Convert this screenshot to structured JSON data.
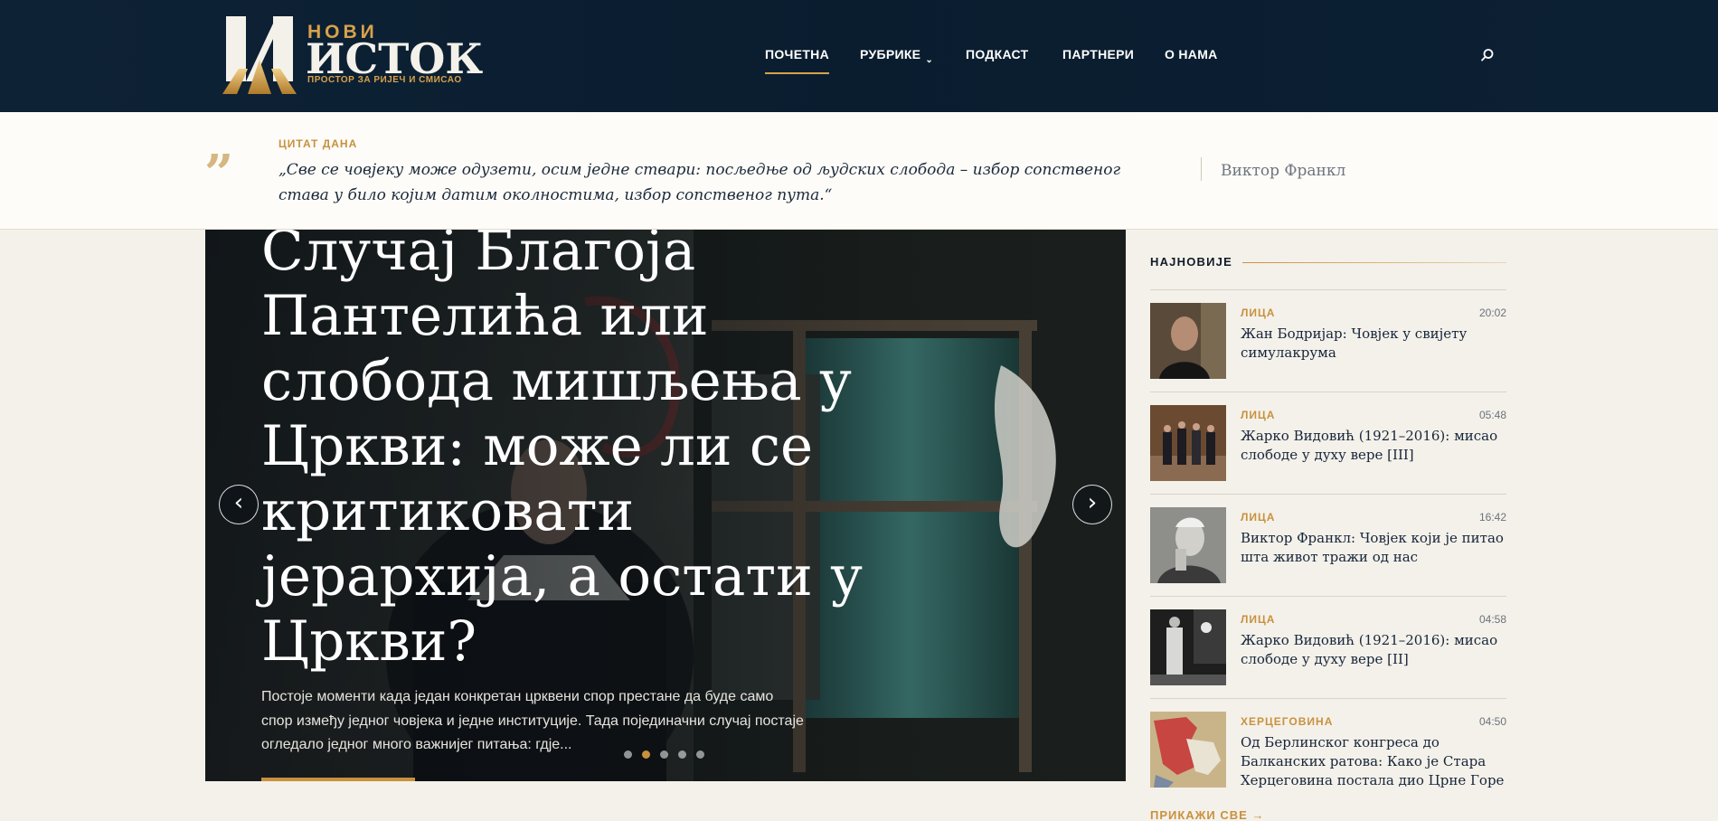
{
  "brand": {
    "name_top": "НОВИ",
    "name_main": "ИСТОК",
    "tagline": "ПРОСТОР ЗА РИЈЕЧ И СМИСАО"
  },
  "nav": {
    "items": [
      {
        "label": "ПОЧЕТНА",
        "active": true
      },
      {
        "label": "РУБРИКЕ",
        "has_dropdown": true
      },
      {
        "label": "ПОДКАСТ"
      },
      {
        "label": "ПАРТНЕРИ"
      },
      {
        "label": "О НАМА"
      }
    ],
    "search_icon": "search-icon"
  },
  "quote": {
    "label": "ЦИТАТ ДАНА",
    "text": "„Све се човјеку може одузети, осим једне ствари: посљедње од људских слобода – избор сопственог става у било којим датим околностима, избор сопственог пута.“",
    "author": "Виктор Франкл"
  },
  "hero": {
    "title": "Случај Благоја Пантелића или слобода мишљења у Цркви: може ли се критиковати јерархија, а остати у Цркви?",
    "excerpt": "Постоје моменти када један конкретан црквени спор престане да буде само спор између једног човјека и једне институције. Тада појединачни случај постаје огледало једног много важнијег питања: гдје...",
    "prev_label": "‹",
    "next_label": "›",
    "slides_count": 5,
    "active_slide": 2
  },
  "sidebar": {
    "heading": "НАЈНОВИЈЕ",
    "items": [
      {
        "category": "ЛИЦА",
        "time": "20:02",
        "title": "Жан Бодријар: Човјек у свијету симулакрума"
      },
      {
        "category": "ЛИЦА",
        "time": "05:48",
        "title": "Жарко Видовић (1921–2016): мисао слободе у духу вере [III]"
      },
      {
        "category": "ЛИЦА",
        "time": "16:42",
        "title": "Виктор Франкл: Човјек који је питао шта живот тражи од нас"
      },
      {
        "category": "ЛИЦА",
        "time": "04:58",
        "title": "Жарко Видовић (1921–2016): мисао слободе у духу вере [II]"
      },
      {
        "category": "ХЕРЦЕГОВИНА",
        "time": "04:50",
        "title": "Од Берлинског конгреса до Балканских ратова: Како је Стара Херцеговина постала дио Црне Горе"
      }
    ],
    "more_label": "ПРИКАЖИ СВЕ →"
  },
  "colors": {
    "header_bg": "#0b1f32",
    "accent": "#c8913d",
    "page_bg": "#f4f1ea"
  }
}
